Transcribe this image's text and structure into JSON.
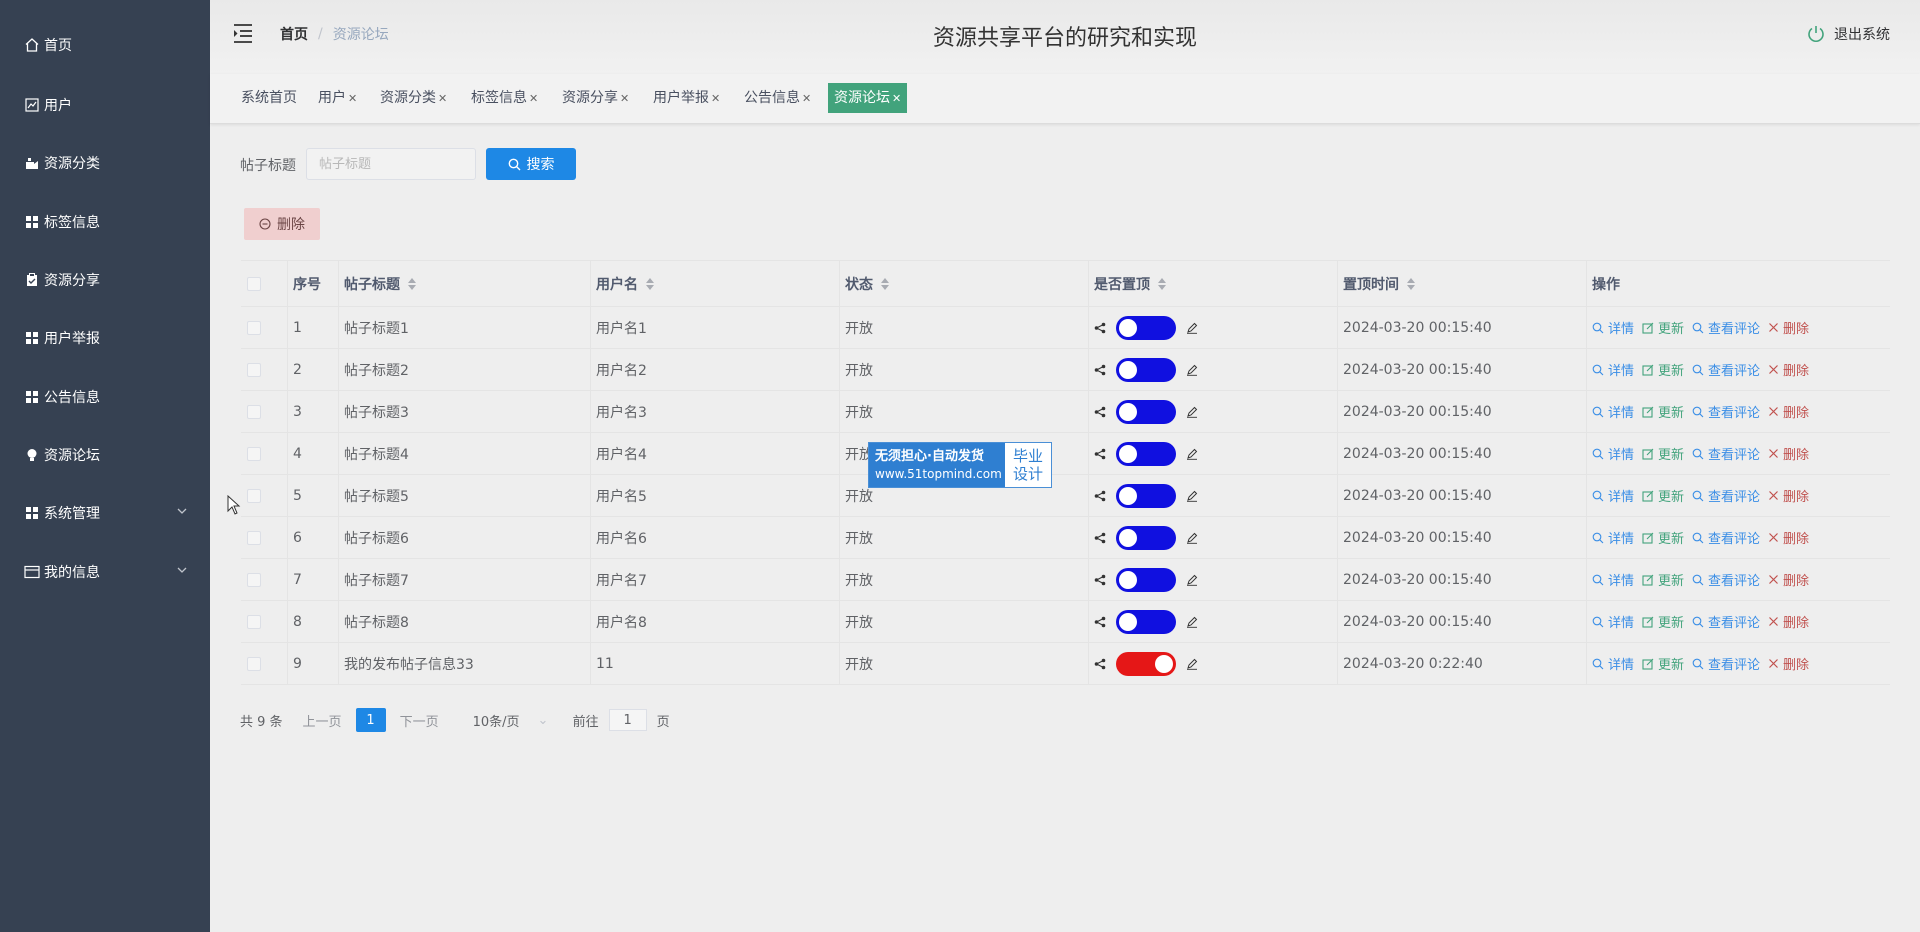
{
  "sidebar": {
    "items": [
      {
        "label": "首页",
        "icon": "home-icon"
      },
      {
        "label": "用户",
        "icon": "chart-icon"
      },
      {
        "label": "资源分类",
        "icon": "category-icon"
      },
      {
        "label": "标签信息",
        "icon": "grid-icon"
      },
      {
        "label": "资源分享",
        "icon": "clipboard-icon"
      },
      {
        "label": "用户举报",
        "icon": "grid-icon"
      },
      {
        "label": "公告信息",
        "icon": "grid-icon"
      },
      {
        "label": "资源论坛",
        "icon": "bulb-icon"
      },
      {
        "label": "系统管理",
        "icon": "grid-icon",
        "expandable": true
      },
      {
        "label": "我的信息",
        "icon": "card-icon",
        "expandable": true
      }
    ]
  },
  "header": {
    "breadcrumb_home": "首页",
    "breadcrumb_sep": "/",
    "breadcrumb_current": "资源论坛",
    "title": "资源共享平台的研究和实现",
    "logout_label": "退出系统"
  },
  "tags": [
    {
      "label": "系统首页",
      "closable": false,
      "active": false
    },
    {
      "label": "用户",
      "closable": true,
      "active": false
    },
    {
      "label": "资源分类",
      "closable": true,
      "active": false
    },
    {
      "label": "标签信息",
      "closable": true,
      "active": false
    },
    {
      "label": "资源分享",
      "closable": true,
      "active": false
    },
    {
      "label": "用户举报",
      "closable": true,
      "active": false
    },
    {
      "label": "公告信息",
      "closable": true,
      "active": false
    },
    {
      "label": "资源论坛",
      "closable": true,
      "active": true
    }
  ],
  "search": {
    "label": "帖子标题",
    "placeholder": "帖子标题",
    "value": "",
    "button_label": "搜索"
  },
  "delete_button_label": "删除",
  "table": {
    "columns": [
      "序号",
      "帖子标题",
      "用户名",
      "状态",
      "是否置顶",
      "置顶时间",
      "操作"
    ],
    "actions": {
      "detail": "详情",
      "update": "更新",
      "comment": "查看评论",
      "delete": "删除"
    },
    "rows": [
      {
        "no": "1",
        "title": "帖子标题1",
        "user": "用户名1",
        "status": "开放",
        "top": false,
        "time": "2024-03-20 00:15:40"
      },
      {
        "no": "2",
        "title": "帖子标题2",
        "user": "用户名2",
        "status": "开放",
        "top": false,
        "time": "2024-03-20 00:15:40"
      },
      {
        "no": "3",
        "title": "帖子标题3",
        "user": "用户名3",
        "status": "开放",
        "top": false,
        "time": "2024-03-20 00:15:40"
      },
      {
        "no": "4",
        "title": "帖子标题4",
        "user": "用户名4",
        "status": "开放",
        "top": false,
        "time": "2024-03-20 00:15:40"
      },
      {
        "no": "5",
        "title": "帖子标题5",
        "user": "用户名5",
        "status": "开放",
        "top": false,
        "time": "2024-03-20 00:15:40"
      },
      {
        "no": "6",
        "title": "帖子标题6",
        "user": "用户名6",
        "status": "开放",
        "top": false,
        "time": "2024-03-20 00:15:40"
      },
      {
        "no": "7",
        "title": "帖子标题7",
        "user": "用户名7",
        "status": "开放",
        "top": false,
        "time": "2024-03-20 00:15:40"
      },
      {
        "no": "8",
        "title": "帖子标题8",
        "user": "用户名8",
        "status": "开放",
        "top": false,
        "time": "2024-03-20 00:15:40"
      },
      {
        "no": "9",
        "title": "我的发布帖子信息33",
        "user": "11",
        "status": "开放",
        "top": true,
        "time": "2024-03-20 0:22:40"
      }
    ]
  },
  "pagination": {
    "total": "共 9 条",
    "prev": "上一页",
    "current": "1",
    "next": "下一页",
    "page_size": "10条/页",
    "goto_label": "前往",
    "goto_value": "1",
    "page_unit": "页"
  },
  "watermark": {
    "line1": "无须担心·自动发货",
    "line2": "www.51topmind.com",
    "right1": "毕业",
    "right2": "设计"
  },
  "colors": {
    "sidebar_bg": "#364152",
    "active_tag": "#42a37c",
    "primary": "#1e88e5",
    "toggle_off": "#1010e0",
    "toggle_on": "#e51717"
  }
}
